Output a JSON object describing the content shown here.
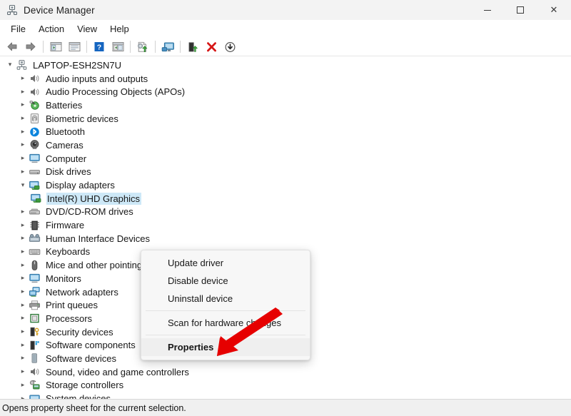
{
  "window": {
    "title": "Device Manager",
    "icon": "device-manager-icon",
    "controls": {
      "minimize": "–",
      "maximize": "□",
      "close": "✕"
    }
  },
  "menubar": {
    "items": [
      {
        "label": "File"
      },
      {
        "label": "Action"
      },
      {
        "label": "View"
      },
      {
        "label": "Help"
      }
    ]
  },
  "toolbar": {
    "buttons": [
      {
        "name": "back-arrow-icon"
      },
      {
        "name": "forward-arrow-icon"
      },
      {
        "name": "show-hide-console-tree-icon"
      },
      {
        "name": "properties-panel-icon"
      },
      {
        "name": "help-icon"
      },
      {
        "name": "show-hide-action-pane-icon"
      },
      {
        "name": "update-driver-icon"
      },
      {
        "name": "scan-for-hardware-changes-icon"
      },
      {
        "name": "enable-device-icon"
      },
      {
        "name": "uninstall-device-icon"
      },
      {
        "name": "disable-device-icon"
      }
    ]
  },
  "tree": {
    "root": {
      "label": "LAPTOP-ESH2SN7U",
      "icon": "computer-root-icon",
      "expanded": true
    },
    "items": [
      {
        "label": "Audio inputs and outputs",
        "icon": "speaker-icon",
        "level": 1,
        "expanded": false
      },
      {
        "label": "Audio Processing Objects (APOs)",
        "icon": "speaker-icon",
        "level": 1,
        "expanded": false
      },
      {
        "label": "Batteries",
        "icon": "battery-icon",
        "level": 1,
        "expanded": false
      },
      {
        "label": "Biometric devices",
        "icon": "fingerprint-icon",
        "level": 1,
        "expanded": false
      },
      {
        "label": "Bluetooth",
        "icon": "bluetooth-icon",
        "level": 1,
        "expanded": false
      },
      {
        "label": "Cameras",
        "icon": "camera-icon",
        "level": 1,
        "expanded": false
      },
      {
        "label": "Computer",
        "icon": "monitor-icon",
        "level": 1,
        "expanded": false
      },
      {
        "label": "Disk drives",
        "icon": "disk-drive-icon",
        "level": 1,
        "expanded": false
      },
      {
        "label": "Display adapters",
        "icon": "display-adapter-icon",
        "level": 1,
        "expanded": true
      },
      {
        "label": "Intel(R) UHD Graphics",
        "icon": "display-adapter-icon",
        "level": 2,
        "selected": true
      },
      {
        "label": "DVD/CD-ROM drives",
        "icon": "optical-drive-icon",
        "level": 1,
        "expanded": false
      },
      {
        "label": "Firmware",
        "icon": "firmware-icon",
        "level": 1,
        "expanded": false
      },
      {
        "label": "Human Interface Devices",
        "icon": "hid-icon",
        "level": 1,
        "expanded": false
      },
      {
        "label": "Keyboards",
        "icon": "keyboard-icon",
        "level": 1,
        "expanded": false
      },
      {
        "label": "Mice and other pointing",
        "icon": "mouse-icon",
        "level": 1,
        "expanded": false
      },
      {
        "label": "Monitors",
        "icon": "monitor-icon",
        "level": 1,
        "expanded": false
      },
      {
        "label": "Network adapters",
        "icon": "network-adapter-icon",
        "level": 1,
        "expanded": false
      },
      {
        "label": "Print queues",
        "icon": "printer-icon",
        "level": 1,
        "expanded": false
      },
      {
        "label": "Processors",
        "icon": "processor-icon",
        "level": 1,
        "expanded": false
      },
      {
        "label": "Security devices",
        "icon": "security-device-icon",
        "level": 1,
        "expanded": false
      },
      {
        "label": "Software components",
        "icon": "software-component-icon",
        "level": 1,
        "expanded": false
      },
      {
        "label": "Software devices",
        "icon": "software-device-icon",
        "level": 1,
        "expanded": false
      },
      {
        "label": "Sound, video and game controllers",
        "icon": "speaker-icon",
        "level": 1,
        "expanded": false
      },
      {
        "label": "Storage controllers",
        "icon": "storage-controller-icon",
        "level": 1,
        "expanded": false
      },
      {
        "label": "System devices",
        "icon": "system-device-icon",
        "level": 1,
        "expanded": false
      }
    ]
  },
  "context_menu": {
    "items": [
      {
        "label": "Update driver",
        "bold": false,
        "highlighted": false
      },
      {
        "label": "Disable device",
        "bold": false,
        "highlighted": false
      },
      {
        "label": "Uninstall device",
        "bold": false,
        "highlighted": false
      },
      {
        "separator": true
      },
      {
        "label": "Scan for hardware changes",
        "bold": false,
        "highlighted": false
      },
      {
        "separator": true
      },
      {
        "label": "Properties",
        "bold": true,
        "highlighted": true
      }
    ]
  },
  "statusbar": {
    "text": "Opens property sheet for the current selection."
  },
  "colors": {
    "selection": "#cde8f7",
    "arrow": "#e60000",
    "titlebar_bg": "#f3f3f3",
    "statusbar_bg": "#f0f0f0",
    "menu_bg": "#f7f7f7"
  }
}
